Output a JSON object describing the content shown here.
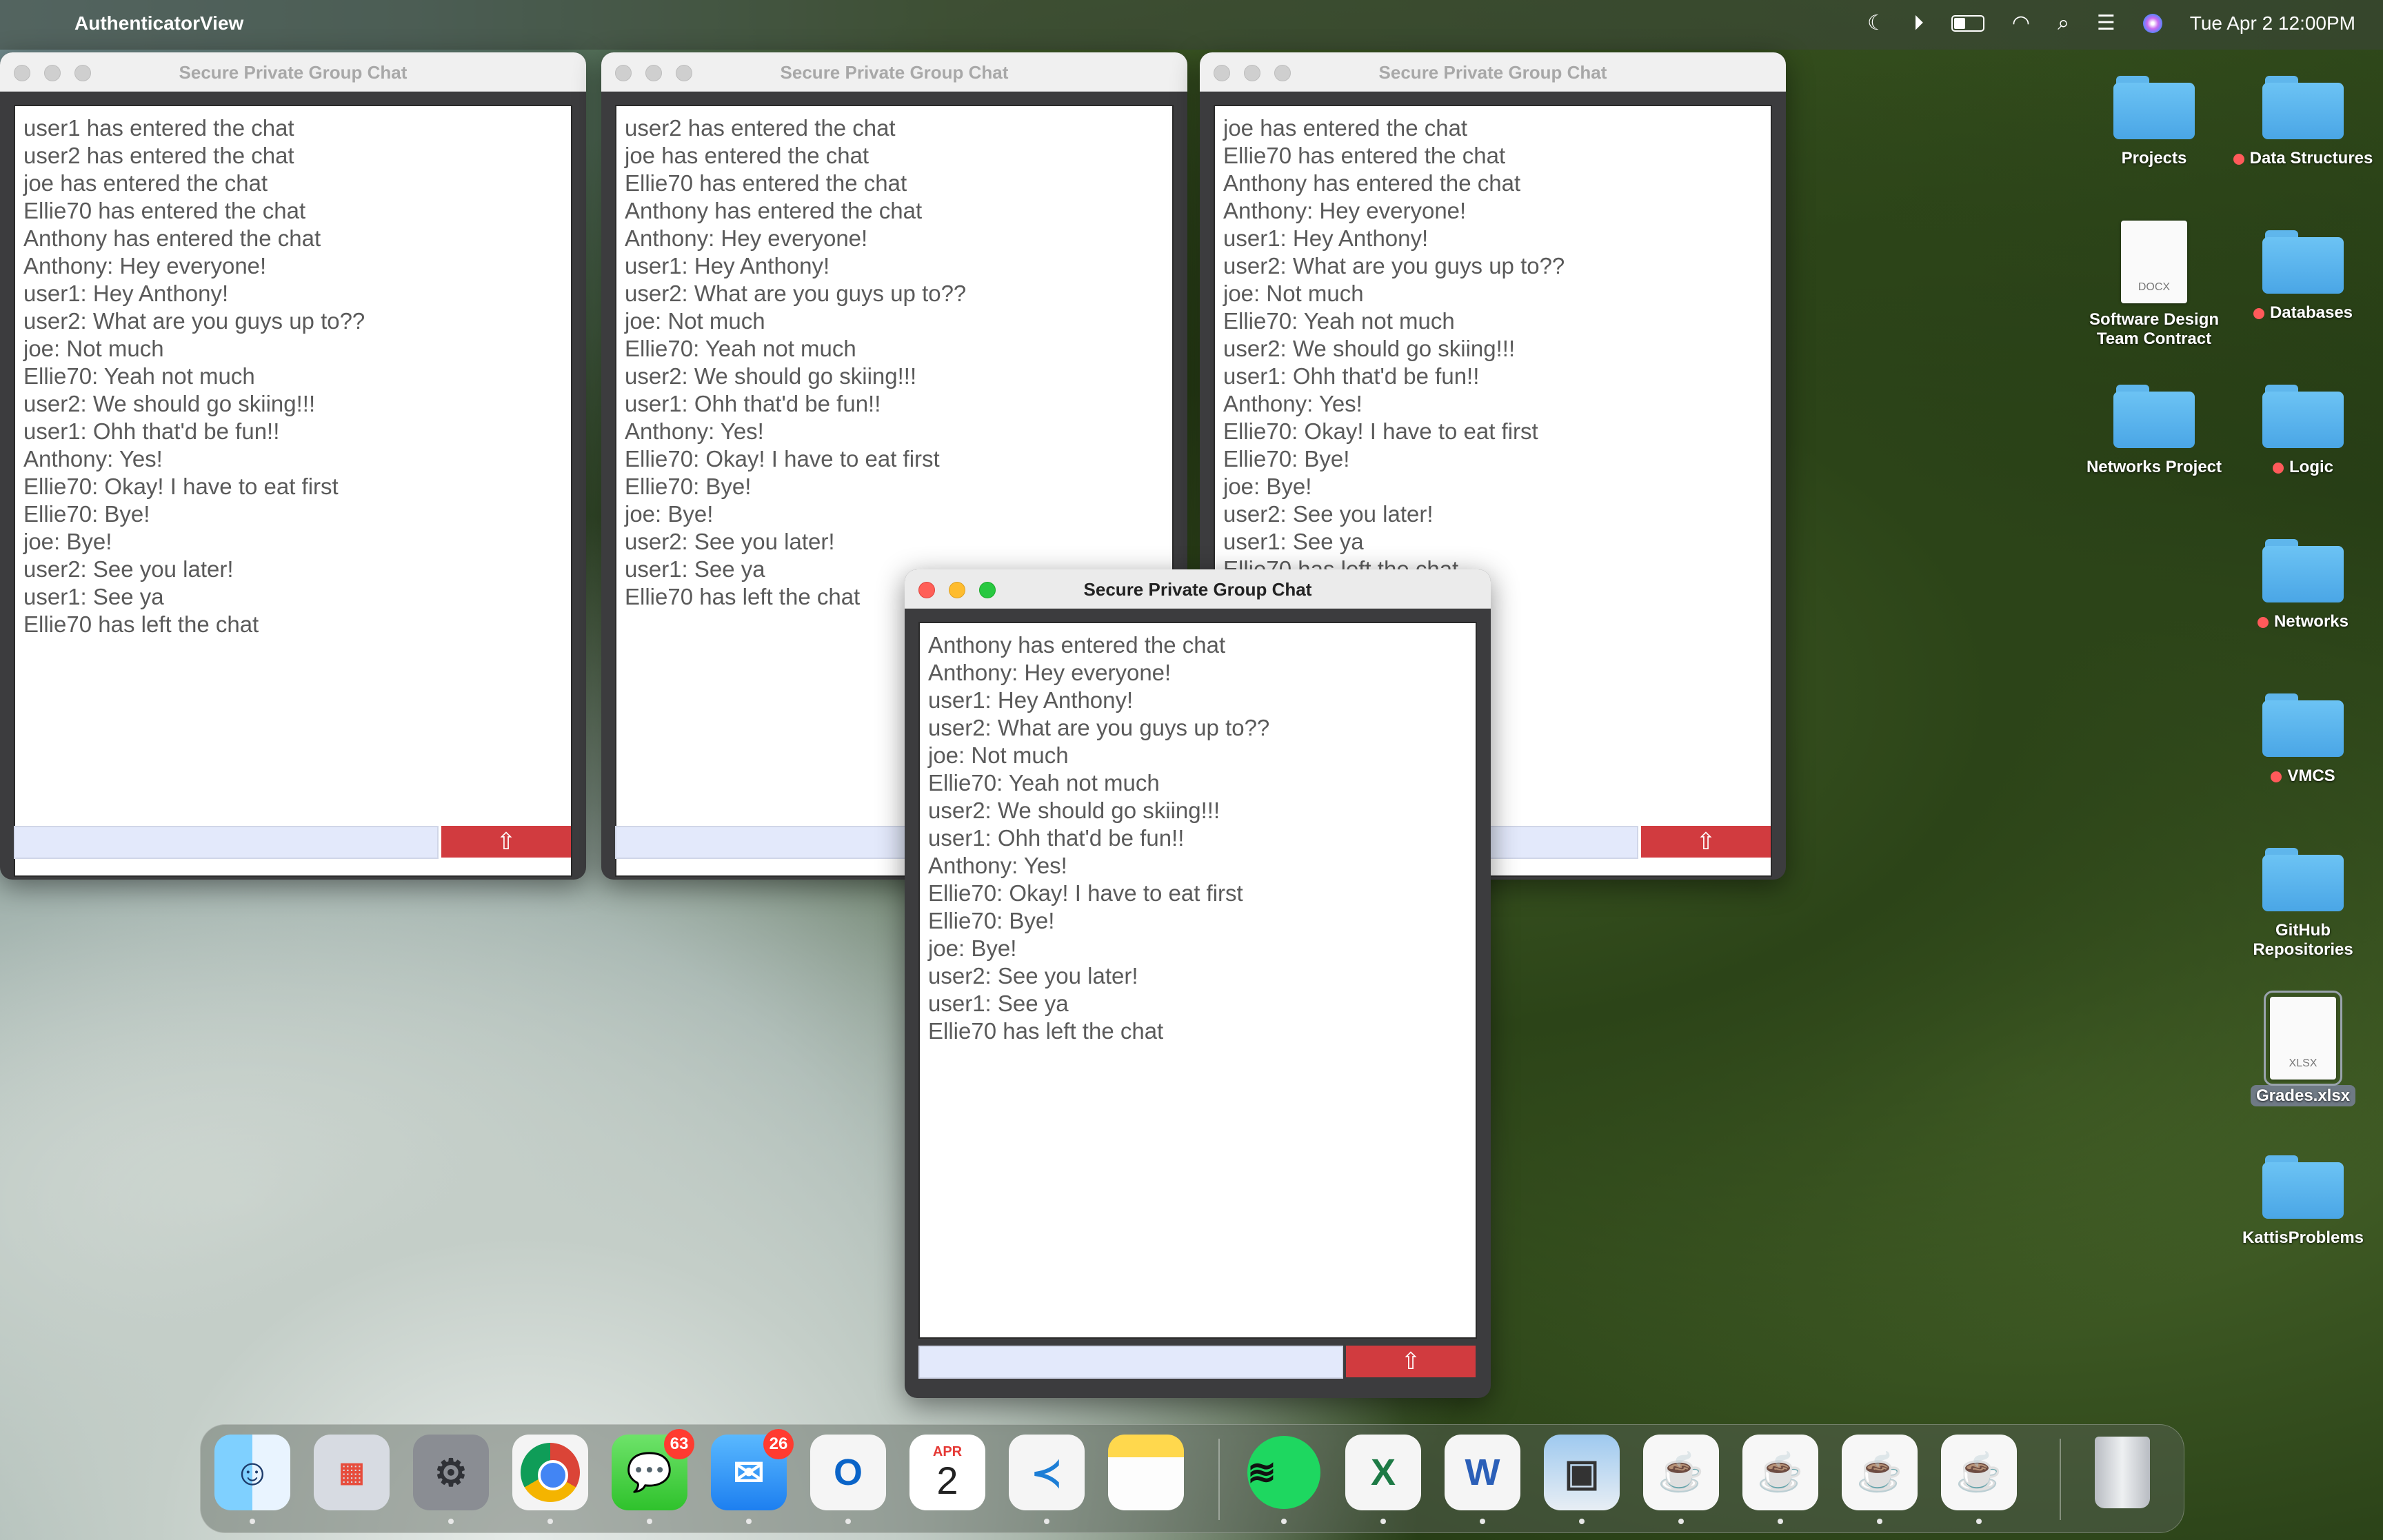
{
  "menubar": {
    "apple_icon": "apple-logo",
    "app_name": "AuthenticatorView",
    "clock": "Tue Apr 2  12:00PM",
    "status_icons": [
      "moon-icon",
      "play-icon",
      "battery-icon",
      "wifi-icon",
      "search-icon",
      "control-center-icon",
      "siri-icon"
    ]
  },
  "windows": {
    "title": "Secure Private Group Chat",
    "send_glyph": "⇧",
    "win1": {
      "lines": [
        "user1 has entered the chat",
        "user2 has entered the chat",
        "joe has entered the chat",
        "Ellie70 has entered the chat",
        "Anthony has entered the chat",
        "Anthony: Hey everyone!",
        "user1: Hey Anthony!",
        "user2: What are you guys up to??",
        "joe: Not much",
        "Ellie70: Yeah not much",
        "user2: We should go skiing!!!",
        "user1: Ohh that'd be fun!!",
        "Anthony: Yes!",
        "Ellie70: Okay! I have to eat first",
        "Ellie70: Bye!",
        "joe: Bye!",
        "user2: See you later!",
        "user1: See ya",
        "Ellie70 has left the chat"
      ]
    },
    "win2": {
      "lines": [
        "user2 has entered the chat",
        "joe has entered the chat",
        "Ellie70 has entered the chat",
        "Anthony has entered the chat",
        "Anthony: Hey everyone!",
        "user1: Hey Anthony!",
        "user2: What are you guys up to??",
        "joe: Not much",
        "Ellie70: Yeah not much",
        "user2: We should go skiing!!!",
        "user1: Ohh that'd be fun!!",
        "Anthony: Yes!",
        "Ellie70: Okay! I have to eat first",
        "Ellie70: Bye!",
        "joe: Bye!",
        "user2: See you later!",
        "user1: See ya",
        "Ellie70 has left the chat"
      ]
    },
    "win3": {
      "lines": [
        "joe has entered the chat",
        "Ellie70 has entered the chat",
        "Anthony has entered the chat",
        "Anthony: Hey everyone!",
        "user1: Hey Anthony!",
        "user2: What are you guys up to??",
        "joe: Not much",
        "Ellie70: Yeah not much",
        "user2: We should go skiing!!!",
        "user1: Ohh that'd be fun!!",
        "Anthony: Yes!",
        "Ellie70: Okay! I have to eat first",
        "Ellie70: Bye!",
        "joe: Bye!",
        "user2: See you later!",
        "user1: See ya",
        "Ellie70 has left the chat"
      ]
    },
    "win4": {
      "lines": [
        "Anthony has entered the chat",
        "Anthony: Hey everyone!",
        "user1: Hey Anthony!",
        "user2: What are you guys up to??",
        "joe: Not much",
        "Ellie70: Yeah not much",
        "user2: We should go skiing!!!",
        "user1: Ohh that'd be fun!!",
        "Anthony: Yes!",
        "Ellie70: Okay! I have to eat first",
        "Ellie70: Bye!",
        "joe: Bye!",
        "user2: See you later!",
        "user1: See ya",
        "Ellie70 has left the chat"
      ]
    }
  },
  "desktop": {
    "projects": "Projects",
    "data_structures": "Data Structures",
    "software_design": "Software Design Team Contract",
    "software_design_ext": "DOCX",
    "databases": "Databases",
    "networks_project": "Networks Project",
    "logic": "Logic",
    "networks": "Networks",
    "vmcs": "VMCS",
    "github": "GitHub Repositories",
    "grades": "Grades.xlsx",
    "grades_ext": "XLSX",
    "kattis": "KattisProblems",
    "tag_color": "#ff5a5a"
  },
  "dock": {
    "messages_badge": "63",
    "mail_badge": "26",
    "calendar_month": "APR",
    "calendar_day": "2",
    "items": [
      "Finder",
      "Launchpad",
      "System Settings",
      "Chrome",
      "Messages",
      "Mail",
      "Outlook",
      "Calendar",
      "VS Code",
      "Notes",
      "Spotify",
      "Excel",
      "Word",
      "Preview",
      "Java",
      "Java",
      "Java",
      "Java",
      "Trash"
    ]
  }
}
